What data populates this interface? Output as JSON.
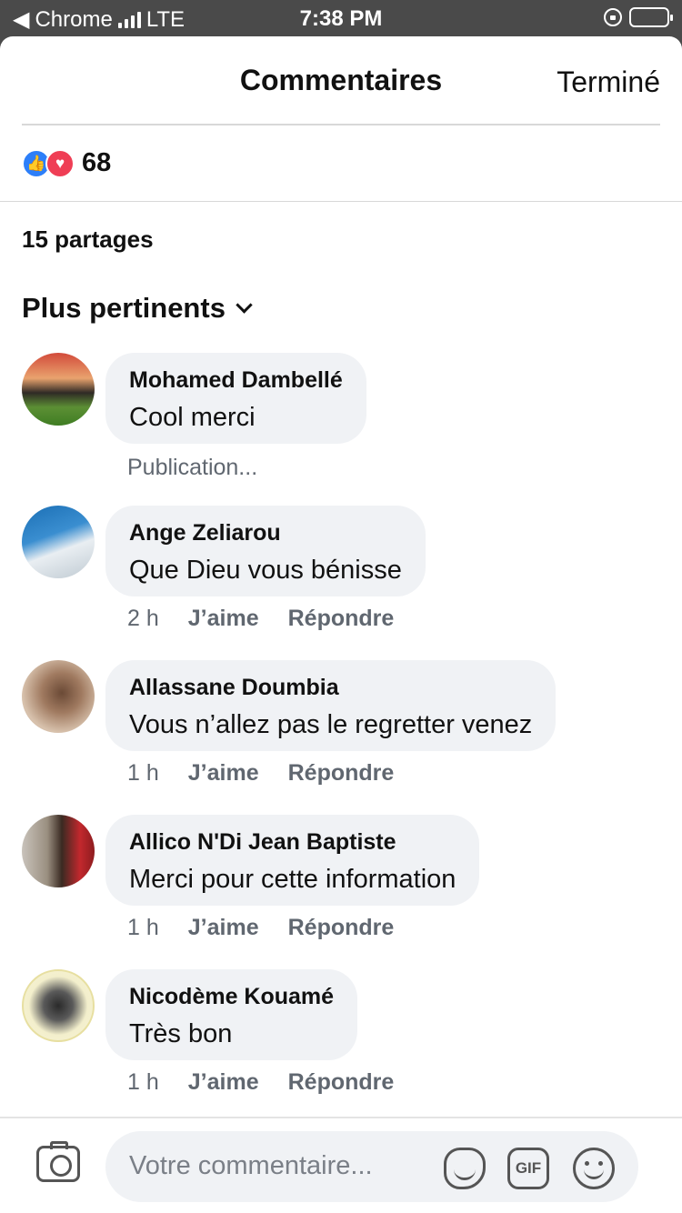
{
  "status_bar": {
    "back_app": "Chrome",
    "network": "LTE",
    "time": "7:38 PM"
  },
  "header": {
    "title": "Commentaires",
    "done_label": "Terminé"
  },
  "reactions": {
    "count": "68",
    "icons": [
      "like-icon",
      "love-icon"
    ],
    "colors": {
      "like": "#2d7ff9",
      "love": "#ef3e55"
    }
  },
  "shares": "15 partages",
  "sort": {
    "label": "Plus pertinents"
  },
  "comments": [
    {
      "author": "Mohamed Dambellé",
      "text": "Cool merci",
      "status": "Publication..."
    },
    {
      "author": "Ange Zeliarou",
      "text": "Que Dieu vous bénisse",
      "time": "2 h",
      "like": "J’aime",
      "reply": "Répondre"
    },
    {
      "author": "Allassane Doumbia",
      "text": "Vous n’allez pas le regretter venez",
      "time": "1 h",
      "like": "J’aime",
      "reply": "Répondre"
    },
    {
      "author": "Allico N'Di Jean Baptiste",
      "text": "Merci pour cette information",
      "time": "1 h",
      "like": "J’aime",
      "reply": "Répondre"
    },
    {
      "author": "Nicodème Kouamé",
      "text": "Très bon",
      "time": "1 h",
      "like": "J’aime",
      "reply": "Répondre"
    }
  ],
  "composer": {
    "placeholder": "Votre commentaire...",
    "gif_label": "GIF"
  }
}
